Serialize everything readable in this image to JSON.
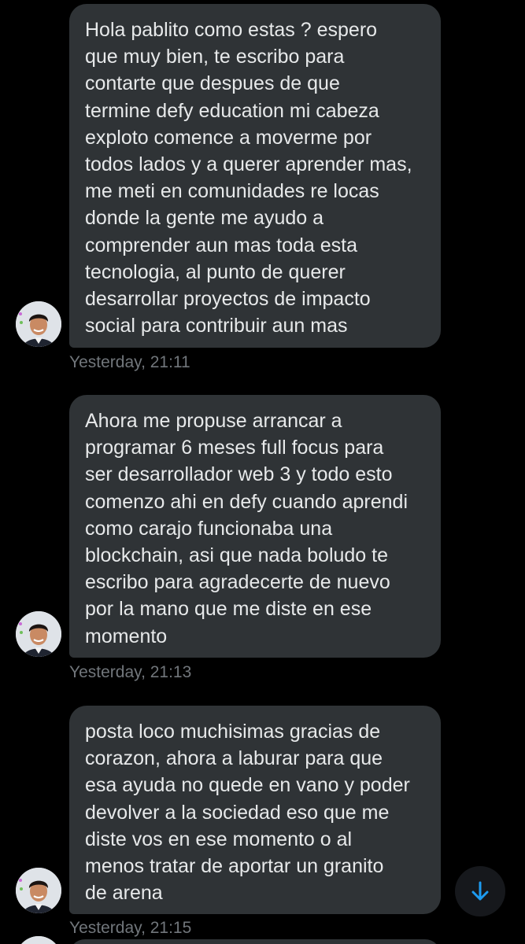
{
  "messages": [
    {
      "text": "Hola pablito como estas ? espero\nque muy bien, te escribo para\ncontarte que despues de que\ntermine defy education mi cabeza\nexploto comence a moverme por\ntodos lados y a querer aprender mas,\nme meti en comunidades re locas\ndonde la gente me ayudo a\ncomprender aun mas toda esta\ntecnologia, al punto de querer\ndesarrollar proyectos de impacto\nsocial para contribuir aun mas",
      "timestamp": "Yesterday, 21:11"
    },
    {
      "text": "Ahora me propuse arrancar a\nprogramar 6 meses full focus para\nser desarrollador web 3 y todo esto\ncomenzo ahi en defy cuando aprendi\ncomo carajo funcionaba una\nblockchain, asi que nada boludo te\nescribo para agradecerte de nuevo\npor la mano que me diste en ese\nmomento",
      "timestamp": "Yesterday, 21:13"
    },
    {
      "text": "posta loco muchisimas gracias de\ncorazon, ahora a laburar para que\nesa ayuda no quede en vano y poder\ndevolver a la sociedad eso que me\ndiste vos en ese momento o al\nmenos tratar de aportar un granito\nde arena",
      "timestamp": "Yesterday, 21:15"
    }
  ],
  "scroll_button": {
    "icon": "arrow-down-icon"
  },
  "colors": {
    "background": "#000000",
    "bubble": "#2f3336",
    "text": "#e7e9ea",
    "timestamp": "#71767b",
    "accent": "#1d9bf0"
  }
}
